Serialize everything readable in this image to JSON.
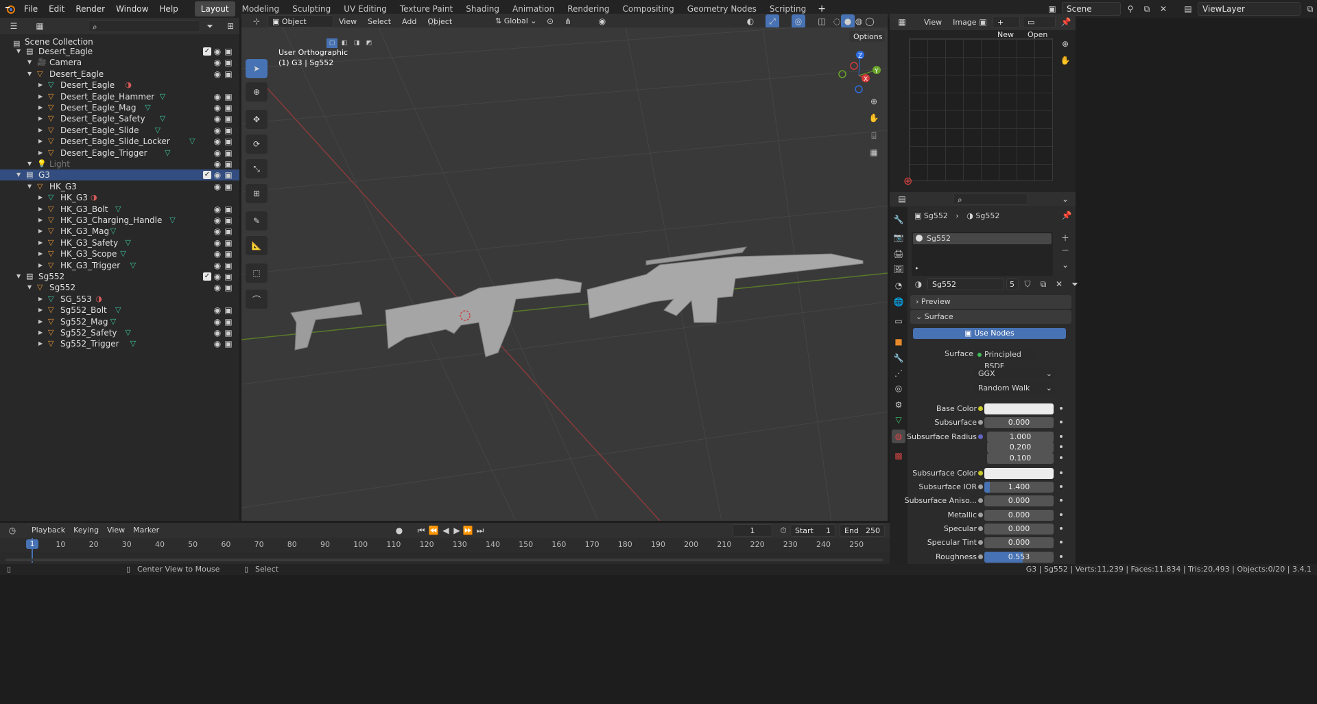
{
  "app": {
    "logo": "blender-logo-icon"
  },
  "menus": [
    "File",
    "Edit",
    "Render",
    "Window",
    "Help"
  ],
  "workspaces": [
    "Layout",
    "Modeling",
    "Sculpting",
    "UV Editing",
    "Texture Paint",
    "Shading",
    "Animation",
    "Rendering",
    "Compositing",
    "Geometry Nodes",
    "Scripting"
  ],
  "active_workspace": "Layout",
  "scene": {
    "scene_name": "Scene",
    "view_layer": "ViewLayer"
  },
  "outliner": {
    "root": "Scene Collection",
    "rows": [
      {
        "label": "Desert_Eagle",
        "type": "collection",
        "indent": 0,
        "checkbox": true,
        "vis": true
      },
      {
        "label": "Camera",
        "type": "camera",
        "indent": 1,
        "vis": true
      },
      {
        "label": "Desert_Eagle",
        "type": "empty",
        "indent": 1,
        "vis": true
      },
      {
        "label": "Desert_Eagle",
        "type": "mesh",
        "indent": 2,
        "mat": true,
        "vis": false
      },
      {
        "label": "Desert_Eagle_Hammer",
        "type": "object",
        "indent": 2,
        "mesh": true,
        "vis": true
      },
      {
        "label": "Desert_Eagle_Mag",
        "type": "object",
        "indent": 2,
        "mesh": true,
        "vis": true
      },
      {
        "label": "Desert_Eagle_Safety",
        "type": "object",
        "indent": 2,
        "mesh": true,
        "vis": true
      },
      {
        "label": "Desert_Eagle_Slide",
        "type": "object",
        "indent": 2,
        "mesh": true,
        "vis": true
      },
      {
        "label": "Desert_Eagle_Slide_Locker",
        "type": "object",
        "indent": 2,
        "mesh": true,
        "vis": true
      },
      {
        "label": "Desert_Eagle_Trigger",
        "type": "object",
        "indent": 2,
        "mesh": true,
        "vis": true
      },
      {
        "label": "Light",
        "type": "light",
        "indent": 1,
        "dim": true,
        "vis": true
      },
      {
        "label": "G3",
        "type": "collection",
        "indent": 0,
        "checkbox": true,
        "vis": true,
        "selected": true
      },
      {
        "label": "HK_G3",
        "type": "empty",
        "indent": 1,
        "vis": true
      },
      {
        "label": "HK_G3",
        "type": "mesh",
        "indent": 2,
        "mat": true,
        "vis": false
      },
      {
        "label": "HK_G3_Bolt",
        "type": "object",
        "indent": 2,
        "mesh": true,
        "vis": true
      },
      {
        "label": "HK_G3_Charging_Handle",
        "type": "object",
        "indent": 2,
        "mesh": true,
        "vis": true
      },
      {
        "label": "HK_G3_Mag",
        "type": "object",
        "indent": 2,
        "mesh": true,
        "vis": true
      },
      {
        "label": "HK_G3_Safety",
        "type": "object",
        "indent": 2,
        "mesh": true,
        "vis": true
      },
      {
        "label": "HK_G3_Scope",
        "type": "object",
        "indent": 2,
        "mesh": true,
        "vis": true
      },
      {
        "label": "HK_G3_Trigger",
        "type": "object",
        "indent": 2,
        "mesh": true,
        "vis": true
      },
      {
        "label": "Sg552",
        "type": "collection",
        "indent": 0,
        "checkbox": true,
        "vis": true
      },
      {
        "label": "Sg552",
        "type": "empty",
        "indent": 1,
        "vis": true
      },
      {
        "label": "SG_553",
        "type": "mesh",
        "indent": 2,
        "mat": true,
        "vis": false
      },
      {
        "label": "Sg552_Bolt",
        "type": "object",
        "indent": 2,
        "mesh": true,
        "vis": true
      },
      {
        "label": "Sg552_Mag",
        "type": "object",
        "indent": 2,
        "mesh": true,
        "vis": true
      },
      {
        "label": "Sg552_Safety",
        "type": "object",
        "indent": 2,
        "mesh": true,
        "vis": true
      },
      {
        "label": "Sg552_Trigger",
        "type": "object",
        "indent": 2,
        "mesh": true,
        "vis": true
      }
    ]
  },
  "viewport": {
    "mode": "Object Mode",
    "menus": [
      "View",
      "Select",
      "Add",
      "Object"
    ],
    "transform": "Global",
    "options": "Options",
    "overlay_title": "User Orthographic",
    "overlay_sub": "(1) G3 | Sg552"
  },
  "image_editor": {
    "menus": [
      "View",
      "Image"
    ],
    "new": "New",
    "open": "Open"
  },
  "properties": {
    "breadcrumb_obj": "Sg552",
    "breadcrumb_mat": "Sg552",
    "slot": "Sg552",
    "material_name": "Sg552",
    "users": "5",
    "preview": "Preview",
    "surface_panel": "Surface",
    "use_nodes": "Use Nodes",
    "surface_label": "Surface",
    "surface_value": "Principled BSDF",
    "dist": "GGX",
    "sss_method": "Random Walk",
    "rows": [
      {
        "label": "Base Color",
        "value": "",
        "type": "color"
      },
      {
        "label": "Subsurface",
        "value": "0.000"
      },
      {
        "label": "Subsurface Radius",
        "value": "1.000"
      },
      {
        "label": "",
        "value": "0.200"
      },
      {
        "label": "",
        "value": "0.100"
      },
      {
        "label": "Subsurface Color",
        "value": "",
        "type": "color"
      },
      {
        "label": "Subsurface IOR",
        "value": "1.400",
        "fill": 0.08
      },
      {
        "label": "Subsurface Aniso...",
        "value": "0.000"
      },
      {
        "label": "Metallic",
        "value": "0.000"
      },
      {
        "label": "Specular",
        "value": "0.000"
      },
      {
        "label": "Specular Tint",
        "value": "0.000"
      },
      {
        "label": "Roughness",
        "value": "0.553",
        "fill": 0.553
      }
    ]
  },
  "timeline": {
    "menus": [
      "Playback",
      "Keying",
      "View",
      "Marker"
    ],
    "current": "1",
    "start_label": "Start",
    "start": "1",
    "end_label": "End",
    "end": "250",
    "ticks": [
      "1",
      "10",
      "20",
      "30",
      "40",
      "50",
      "60",
      "70",
      "80",
      "90",
      "100",
      "110",
      "120",
      "130",
      "140",
      "150",
      "160",
      "170",
      "180",
      "190",
      "200",
      "210",
      "220",
      "230",
      "240",
      "250"
    ]
  },
  "status": {
    "hint1": "Center View to Mouse",
    "hint2": "Select",
    "stats": "G3 | Sg552 | Verts:11,239 | Faces:11,834 | Tris:20,493 | Objects:0/20 | 3.4.1"
  }
}
